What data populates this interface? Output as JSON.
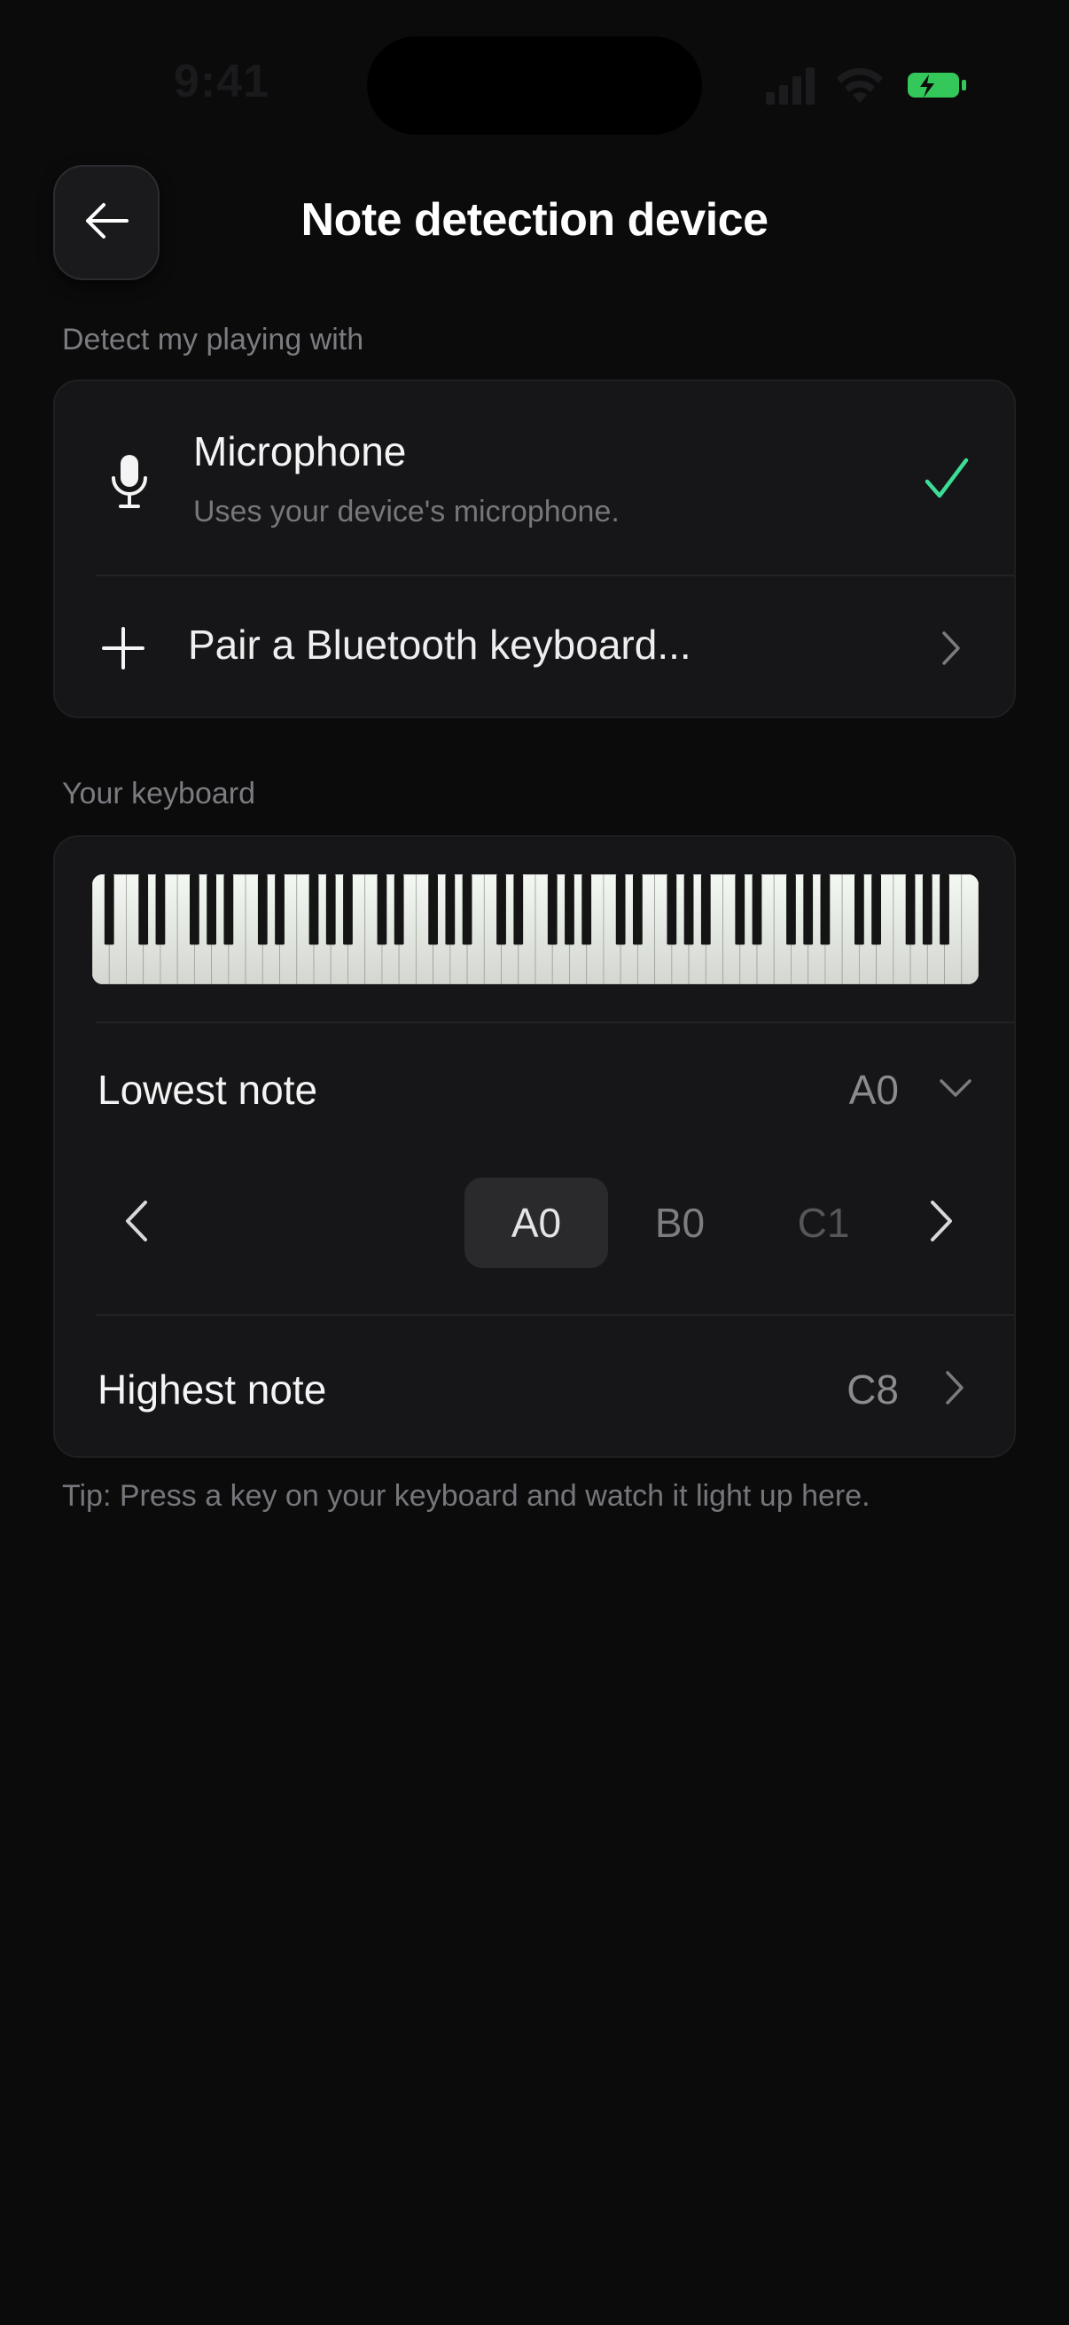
{
  "status_bar": {
    "time": "9:41",
    "icons": [
      "cellular-signal-icon",
      "wifi-icon",
      "battery-icon"
    ]
  },
  "header": {
    "title": "Note detection device",
    "back_icon": "arrow-left-icon"
  },
  "detection": {
    "section_label": "Detect my playing with",
    "microphone": {
      "title": "Microphone",
      "subtitle": "Uses your device's microphone.",
      "selected": true,
      "icon": "microphone-icon"
    },
    "bluetooth": {
      "label": "Pair a Bluetooth keyboard...",
      "icon": "plus-icon"
    }
  },
  "keyboard": {
    "section_label": "Your keyboard",
    "lowest_note": {
      "label": "Lowest note",
      "value": "A0",
      "picker_options": [
        "A0",
        "B0",
        "C1"
      ],
      "selected": "A0"
    },
    "highest_note": {
      "label": "Highest note",
      "value": "C8"
    },
    "range_start": "A0",
    "range_end": "C8"
  },
  "tip": "Tip: Press a key on your keyboard and watch it light up here.",
  "colors": {
    "accent": "#3ddc97",
    "battery": "#34c759",
    "background": "#0b0b0c",
    "card": "#161618"
  }
}
